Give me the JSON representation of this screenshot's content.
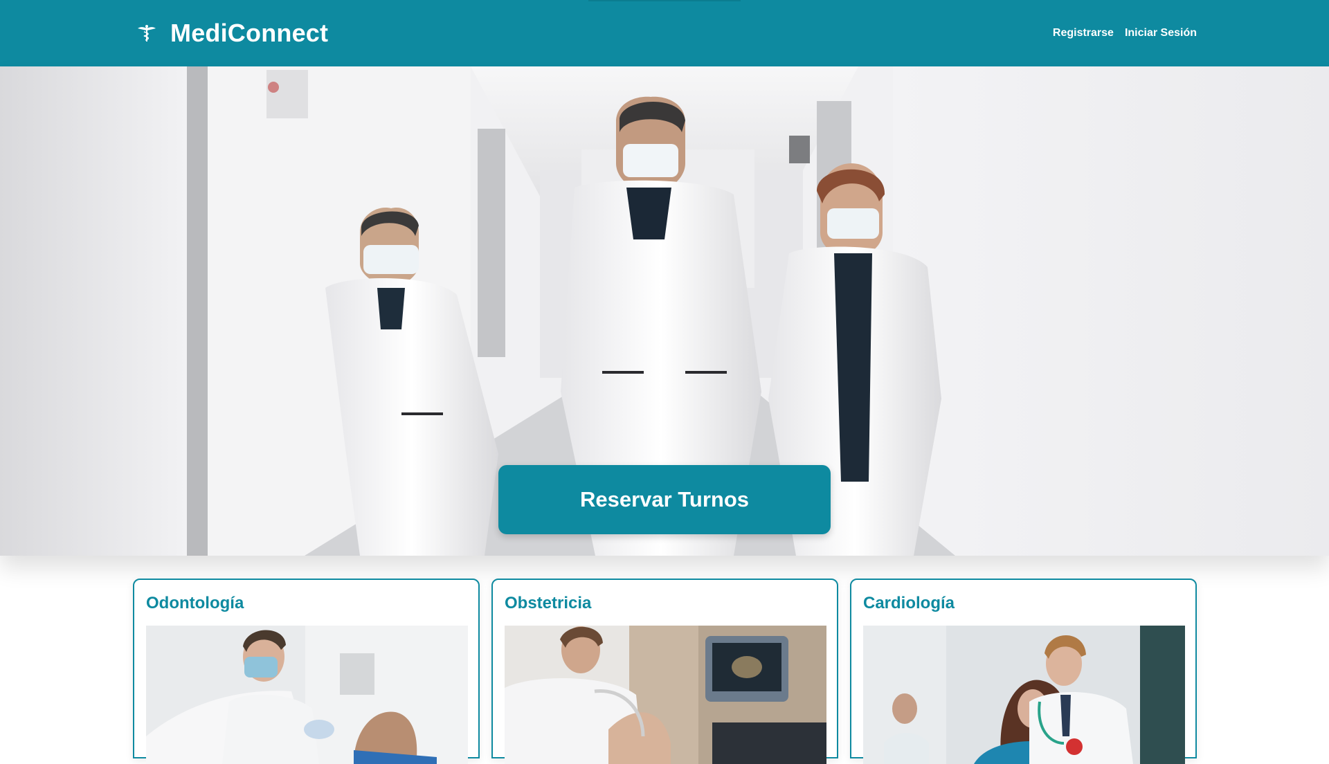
{
  "header": {
    "brand_name": "MediConnect",
    "brand_icon": "caduceus-icon",
    "nav": [
      {
        "label": "Registrarse"
      },
      {
        "label": "Iniciar Sesión"
      }
    ]
  },
  "hero": {
    "cta_label": "Reservar Turnos"
  },
  "services": [
    {
      "title": "Odontología",
      "image": "dentist-photo"
    },
    {
      "title": "Obstetricia",
      "image": "ultrasound-photo"
    },
    {
      "title": "Cardiología",
      "image": "cardiology-photo"
    }
  ],
  "colors": {
    "primary": "#0e8aa0",
    "background": "#ffffff",
    "text_on_primary": "#ffffff"
  }
}
